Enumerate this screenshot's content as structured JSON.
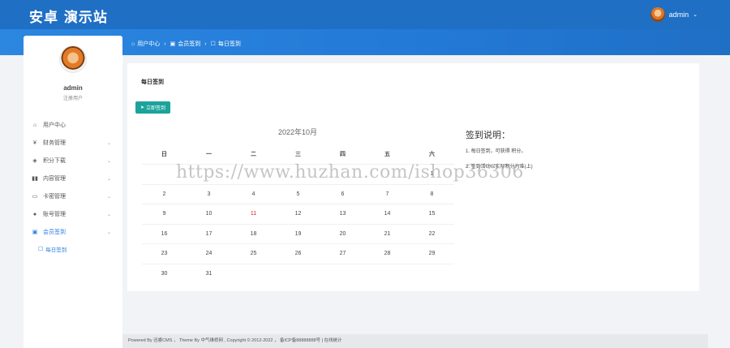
{
  "header": {
    "logo": "安卓 演示站",
    "user": "admin",
    "caret": "⌄"
  },
  "sidebar": {
    "username": "admin",
    "role": "注册用户",
    "items": [
      {
        "label": "用户中心",
        "icon": "home-icon"
      },
      {
        "label": "财务管理",
        "icon": "yen-icon"
      },
      {
        "label": "积分下载",
        "icon": "diamond-icon"
      },
      {
        "label": "内容管理",
        "icon": "columns-icon"
      },
      {
        "label": "卡密管理",
        "icon": "card-icon"
      },
      {
        "label": "账号管理",
        "icon": "user-icon"
      },
      {
        "label": "会员签到",
        "icon": "calendar-icon"
      }
    ],
    "submenu": [
      {
        "label": "每日签到",
        "icon": "checkbox-icon"
      }
    ]
  },
  "breadcrumb": {
    "items": [
      "用户中心",
      "会员签到",
      "每日签到"
    ]
  },
  "panel": {
    "title": "每日签到",
    "button": "立即签到",
    "calendar_title": "2022年10月",
    "weekdays": [
      "日",
      "一",
      "二",
      "三",
      "四",
      "五",
      "六"
    ],
    "rows": [
      [
        "",
        "",
        "",
        "",
        "",
        "",
        "1"
      ],
      [
        "2",
        "3",
        "4",
        "5",
        "6",
        "7",
        "8"
      ],
      [
        "9",
        "10",
        "11",
        "12",
        "13",
        "14",
        "15"
      ],
      [
        "16",
        "17",
        "18",
        "19",
        "20",
        "21",
        "22"
      ],
      [
        "23",
        "24",
        "25",
        "26",
        "27",
        "28",
        "29"
      ],
      [
        "30",
        "31",
        "",
        "",
        "",
        "",
        ""
      ]
    ],
    "notes_title": "签到说明：",
    "notes": [
      "1. 每日签到，可获得 积分。",
      "2. 签到活动以实际积分为准(上)"
    ]
  },
  "watermark": "https://www.huzhan.com/ishop36306",
  "footer": {
    "text": "Powered By 迅睿CMS ，  Theme By 中气维修网 , Copyright © 2012-2022 ， 备ICP备88888888号 | ",
    "link": "在线统计"
  },
  "colors": {
    "primary": "#1f6fc5",
    "accent": "#2b7ee1",
    "button": "#1ba39c"
  }
}
